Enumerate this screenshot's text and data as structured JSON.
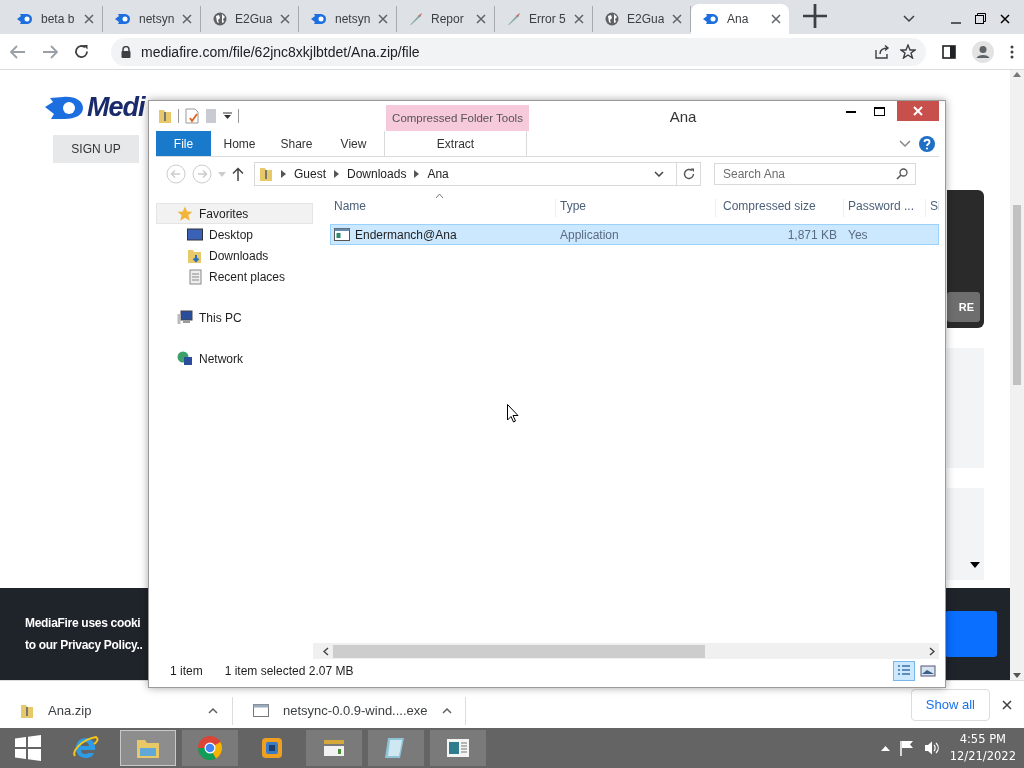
{
  "browser": {
    "tabs": [
      {
        "title": "beta b",
        "kind": "flame",
        "selected": false
      },
      {
        "title": "netsyn",
        "kind": "flame",
        "selected": false
      },
      {
        "title": "E2Gua",
        "kind": "globe",
        "selected": false
      },
      {
        "title": "netsyn",
        "kind": "flame",
        "selected": false
      },
      {
        "title": "Repor",
        "kind": "pen",
        "selected": false
      },
      {
        "title": "Error 5",
        "kind": "pen",
        "selected": false
      },
      {
        "title": "E2Gua",
        "kind": "globe",
        "selected": false
      },
      {
        "title": "Ana",
        "kind": "flame",
        "selected": true
      }
    ],
    "url": "mediafire.com/file/62jnc8xkjlbtdet/Ana.zip/file"
  },
  "page": {
    "logo": "Medi",
    "signup": "SIGN UP",
    "card_button": "RE",
    "cookie_lines": [
      "MediaFire uses cooki",
      "to our Privacy Policy.."
    ]
  },
  "explorer": {
    "title": "Ana",
    "context_tab": "Compressed Folder Tools",
    "ribbon_tabs": [
      {
        "label": "File",
        "kind": "file"
      },
      {
        "label": "Home",
        "kind": "tab"
      },
      {
        "label": "Share",
        "kind": "tab"
      },
      {
        "label": "View",
        "kind": "tab"
      }
    ],
    "context_ribbon_tab": "Extract",
    "path": [
      "Guest",
      "Downloads",
      "Ana"
    ],
    "search": {
      "placeholder": "Search Ana"
    },
    "nav": [
      {
        "label": "Favorites",
        "kind": "star",
        "highlighted": true,
        "children": [
          {
            "label": "Desktop",
            "kind": "desktop",
            "highlighted": false
          },
          {
            "label": "Downloads",
            "kind": "downloads",
            "highlighted": false
          },
          {
            "label": "Recent places",
            "kind": "recent",
            "highlighted": false
          }
        ]
      },
      {
        "label": "This PC",
        "kind": "pc",
        "highlighted": false
      },
      {
        "label": "Network",
        "kind": "network",
        "highlighted": false
      }
    ],
    "columns": [
      "Name",
      "Type",
      "Compressed size",
      "Password ...",
      "Si"
    ],
    "rows": [
      {
        "name": "Endermanch@Ana",
        "type": "Application",
        "compressed_size": "1,871 KB",
        "password": "Yes",
        "selected": true
      }
    ],
    "status": {
      "count": "1 item",
      "selection": "1 item selected  2.07 MB"
    },
    "views": [
      {
        "kind": "details",
        "selected": true
      },
      {
        "kind": "tiles",
        "selected": false
      }
    ]
  },
  "downloads": {
    "items": [
      {
        "name": "Ana.zip",
        "kind": "zip"
      },
      {
        "name": "netsync-0.0.9-wind....exe",
        "kind": "exe"
      }
    ],
    "show_all": "Show all"
  },
  "taskbar": {
    "apps": [
      {
        "kind": "ie",
        "active": false,
        "running": false
      },
      {
        "kind": "explorer",
        "active": true,
        "running": true
      },
      {
        "kind": "chrome",
        "active": false,
        "running": true
      },
      {
        "kind": "vm",
        "active": false,
        "running": false
      },
      {
        "kind": "archive",
        "active": false,
        "running": true
      },
      {
        "kind": "notepad",
        "active": false,
        "running": true
      },
      {
        "kind": "viewer",
        "active": false,
        "running": true
      }
    ],
    "time": "4:55 PM",
    "date": "12/21/2022"
  }
}
